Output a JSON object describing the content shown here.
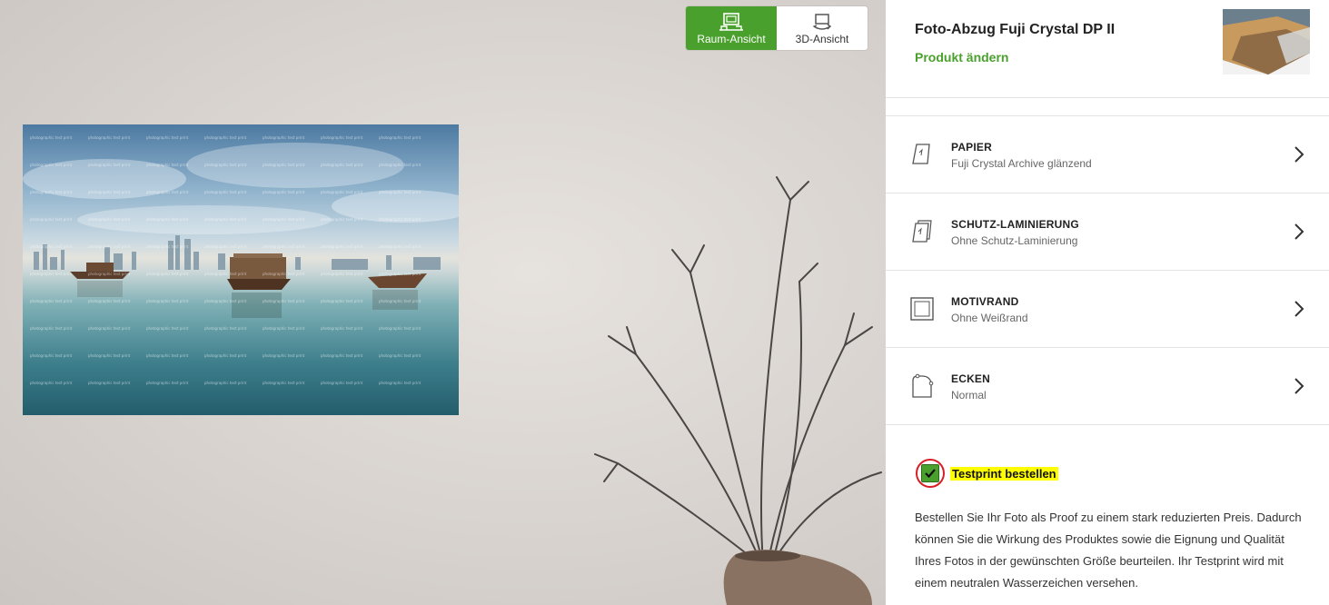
{
  "view_toggle": {
    "room_label": "Raum-Ansicht",
    "threed_label": "3D-Ansicht",
    "active": "room",
    "active_color": "#4aa02c"
  },
  "product": {
    "title": "Foto-Abzug Fuji Crystal DP II",
    "change_label": "Produkt ändern",
    "accent_color": "#4aa02c"
  },
  "photo": {
    "watermark_text": "photographic test print"
  },
  "options": [
    {
      "icon": "paper-icon",
      "name": "PAPIER",
      "value": "Fuji Crystal Archive glänzend"
    },
    {
      "icon": "lamination-icon",
      "name": "SCHUTZ-LAMINIERUNG",
      "value": "Ohne Schutz-Laminierung"
    },
    {
      "icon": "border-icon",
      "name": "MOTIVRAND",
      "value": "Ohne Weißrand"
    },
    {
      "icon": "corners-icon",
      "name": "ECKEN",
      "value": "Normal"
    }
  ],
  "testprint": {
    "checked": true,
    "label": "Testprint bestellen",
    "description": "Bestellen Sie Ihr Foto als Proof zu einem stark reduzierten Preis. Dadurch können Sie die Wirkung des Produktes sowie die Eignung und Qualität Ihres Fotos in der gewünschten Größe beurteilen. Ihr Testprint wird mit einem neutralen Wasserzeichen versehen."
  }
}
